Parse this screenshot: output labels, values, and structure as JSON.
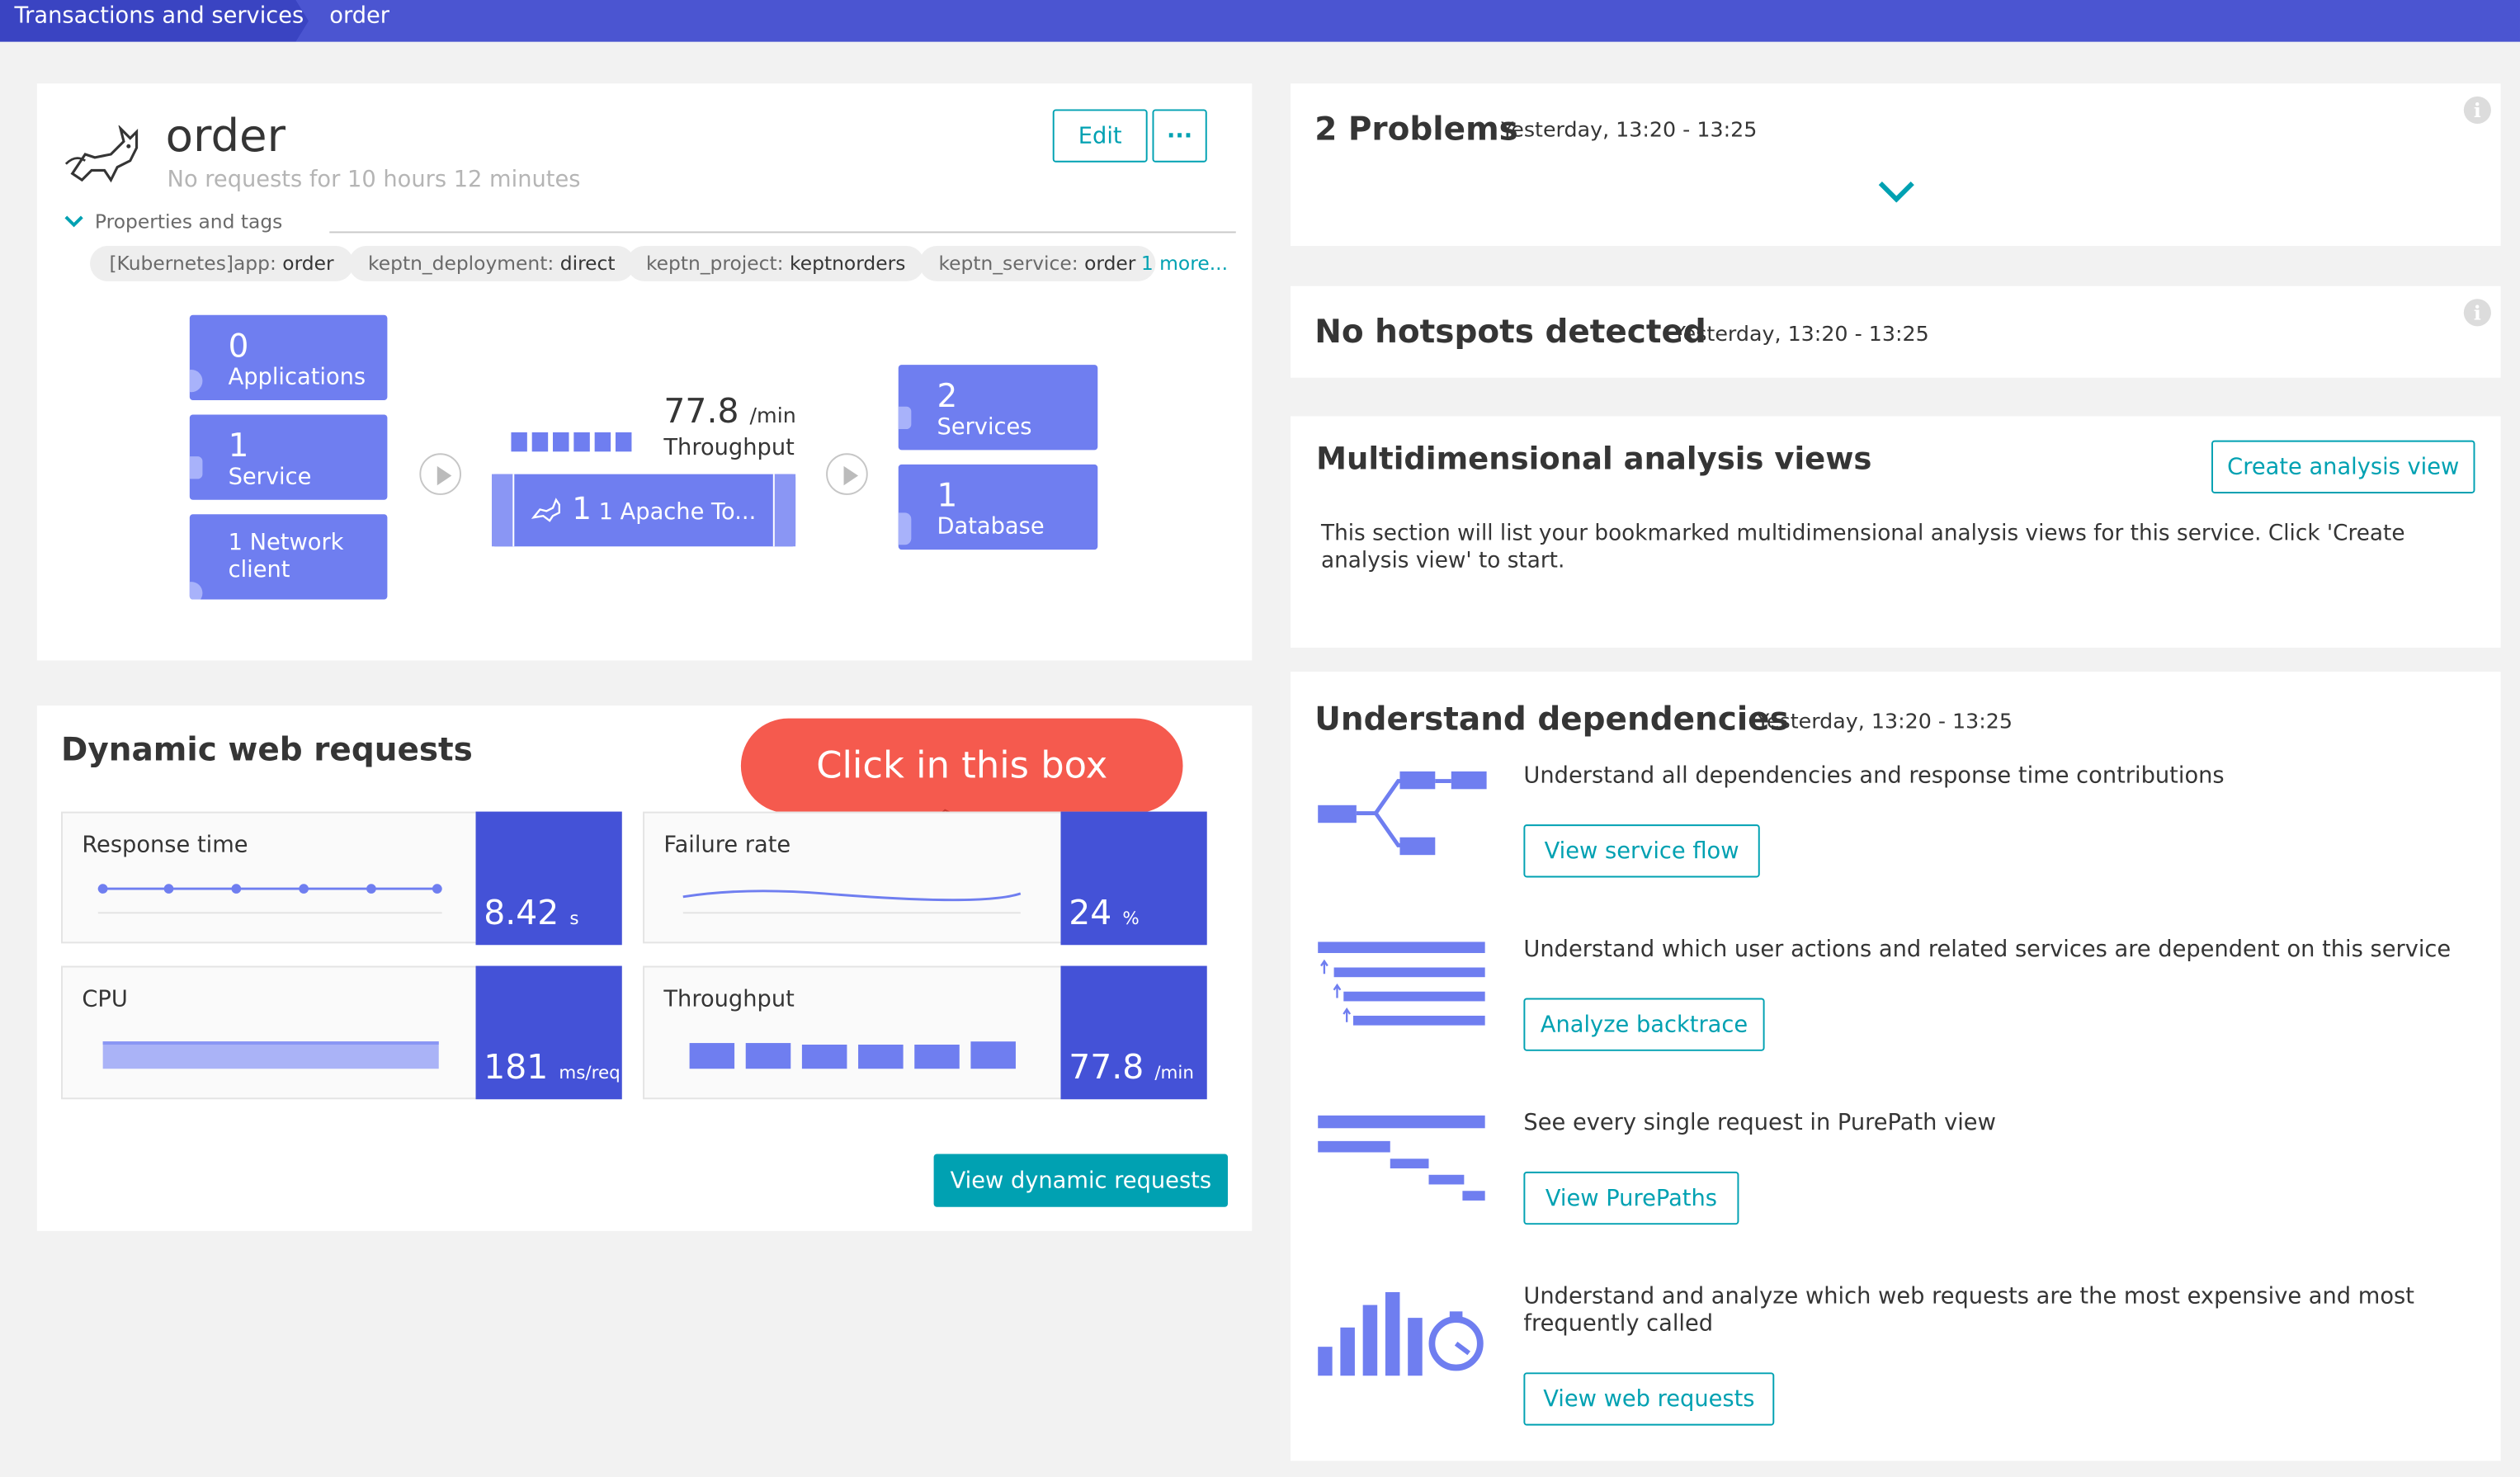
{
  "breadcrumb": {
    "parent": "Transactions and services",
    "current": "order"
  },
  "service": {
    "title": "order",
    "subtitle": "No requests for 10 hours 12 minutes",
    "edit_label": "Edit",
    "more_label": "···",
    "properties_label": "Properties and tags",
    "tags": [
      {
        "key": "[Kubernetes]app:",
        "value": "order"
      },
      {
        "key": "keptn_deployment:",
        "value": "direct"
      },
      {
        "key": "keptn_project:",
        "value": "keptnorders"
      },
      {
        "key": "keptn_service:",
        "value": "order"
      }
    ],
    "more_tags": "1 more..."
  },
  "flow": {
    "callers": [
      {
        "num": "0",
        "label": "Applications"
      },
      {
        "num": "1",
        "label": "Service"
      },
      {
        "label": "1 Network client"
      }
    ],
    "throughput_value": "77.8",
    "throughput_unit": "/min",
    "throughput_label": "Throughput",
    "process_label": "1 Apache To...",
    "callees": [
      {
        "num": "2",
        "label": "Services"
      },
      {
        "num": "1",
        "label": "Database"
      }
    ]
  },
  "dynamic": {
    "title": "Dynamic web requests",
    "callout": "Click in this box",
    "tiles": [
      {
        "name": "Response time",
        "value": "8.42",
        "unit": "s"
      },
      {
        "name": "Failure rate",
        "value": "24",
        "unit": "%"
      },
      {
        "name": "CPU",
        "value": "181",
        "unit": "ms/req"
      },
      {
        "name": "Throughput",
        "value": "77.8",
        "unit": "/min"
      }
    ],
    "button": "View dynamic requests"
  },
  "problems": {
    "title": "2 Problems",
    "time": "Yesterday, 13:20 - 13:25"
  },
  "hotspots": {
    "title": "No hotspots detected",
    "time": "Yesterday, 13:20 - 13:25"
  },
  "mda": {
    "title": "Multidimensional analysis views",
    "button": "Create analysis view",
    "text": "This section will list your bookmarked multidimensional analysis views for this service. Click 'Create analysis view' to start."
  },
  "deps": {
    "title": "Understand dependencies",
    "time": "Yesterday, 13:20 - 13:25",
    "items": [
      {
        "text": "Understand all dependencies and response time contributions",
        "button": "View service flow"
      },
      {
        "text": "Understand which user actions and related services are dependent on this service",
        "button": "Analyze backtrace"
      },
      {
        "text": "See every single request in PurePath view",
        "button": "View PurePaths"
      },
      {
        "text": "Understand and analyze which web requests are the most expensive and most frequently called",
        "button": "View web requests"
      }
    ]
  },
  "colors": {
    "topbar": "#4b55d1",
    "accent": "#00a1b2",
    "metric": "#4452d7",
    "node": "#6f7ef0",
    "callout": "#f55a4e"
  }
}
